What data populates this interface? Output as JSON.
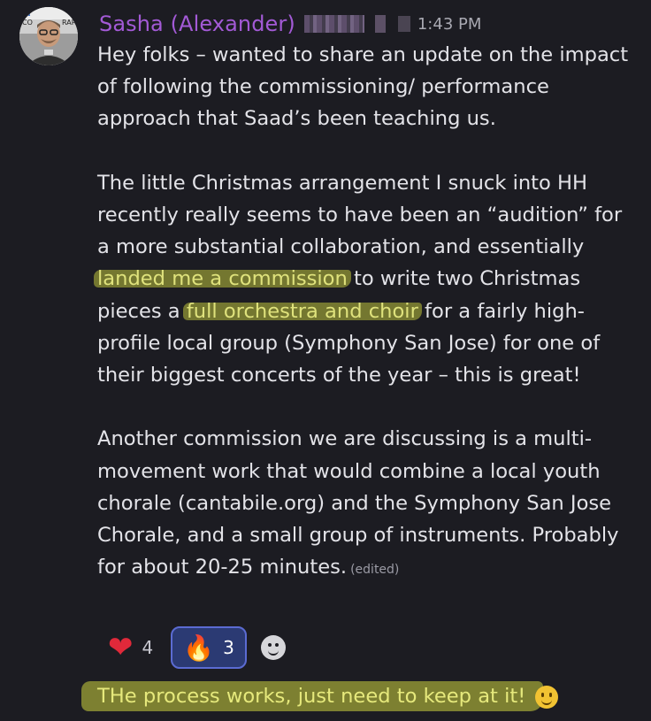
{
  "message": {
    "author": "Sasha (Alexander)",
    "timestamp": "1:43 PM",
    "avatar_text": "CO RARY",
    "paragraph1": "Hey folks – wanted to share an update on the impact of following the commissioning/ performance approach that Saad’s been teaching us.",
    "paragraph2_part1": "The little Christmas arrangement I snuck into HH recently really seems to have been an “audition” for a more substantial collaboration, and essentially ",
    "highlight1": "landed me a commission",
    "paragraph2_part2": " to write two Christmas pieces a ",
    "highlight2": "full orchestra and choir",
    "paragraph2_part3": " for a fairly high-profile local group (Symphony San Jose) for one of their biggest concerts of the year – this is great!",
    "paragraph3": "Another commission we are discussing is a multi-movement work that would combine a local youth chorale (cantabile.org) and the Symphony San Jose Chorale, and a small group of instruments. Probably for about 20-25 minutes.",
    "edited_label": "(edited)"
  },
  "reactions": [
    {
      "emoji": "❤",
      "count": "4",
      "active": false
    },
    {
      "emoji": "🔥",
      "count": "3",
      "active": true
    }
  ],
  "next_message": {
    "text": "THe process works, just need to keep at it!"
  },
  "colors": {
    "background": "#1c1c22",
    "author": "#a35ad6",
    "highlight": "#bec33c",
    "active_reaction": "#2b3a73"
  }
}
